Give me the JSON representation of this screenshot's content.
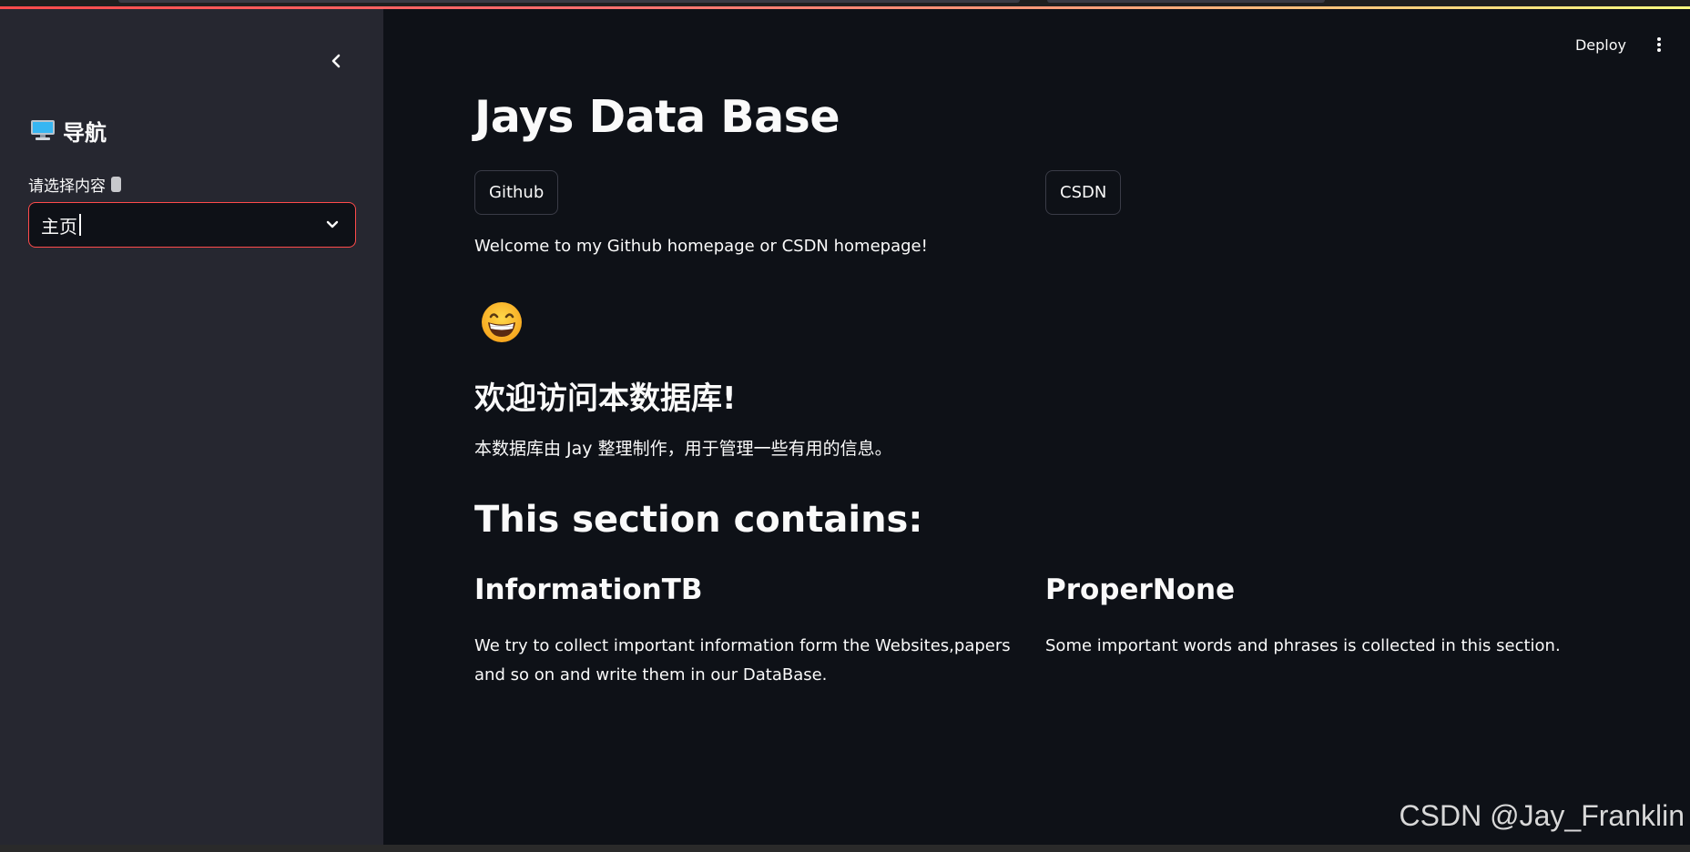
{
  "colors": {
    "background": "#0e1117",
    "sidebar": "#262730",
    "accent": "#ff4b4b",
    "text": "#fafafa"
  },
  "sidebar": {
    "collapse_icon": "chevron-left-icon",
    "title_icon": "desktop-computer-icon",
    "title": "导航",
    "select_label": "请选择内容",
    "help_icon": "help-icon",
    "select_value": "主页",
    "select_icon": "chevron-down-icon"
  },
  "header": {
    "deploy_label": "Deploy",
    "menu_icon": "vertical-dots-icon"
  },
  "main": {
    "title": "Jays Data Base",
    "github_button": "Github",
    "csdn_button": "CSDN",
    "welcome_text": "Welcome to my Github homepage or CSDN homepage!",
    "emoji_icon": "grinning-face-icon",
    "heading_cn": "欢迎访问本数据库!",
    "description_cn": "本数据库由 Jay 整理制作，用于管理一些有用的信息。",
    "section_heading": "This section contains:",
    "columns": [
      {
        "title": "InformationTB",
        "text": "We try to collect important information form the Websites,papers and so on and write them in our DataBase."
      },
      {
        "title": "ProperNone",
        "text": "Some important words and phrases is collected in this section."
      }
    ]
  },
  "watermark": "CSDN @Jay_Franklin"
}
